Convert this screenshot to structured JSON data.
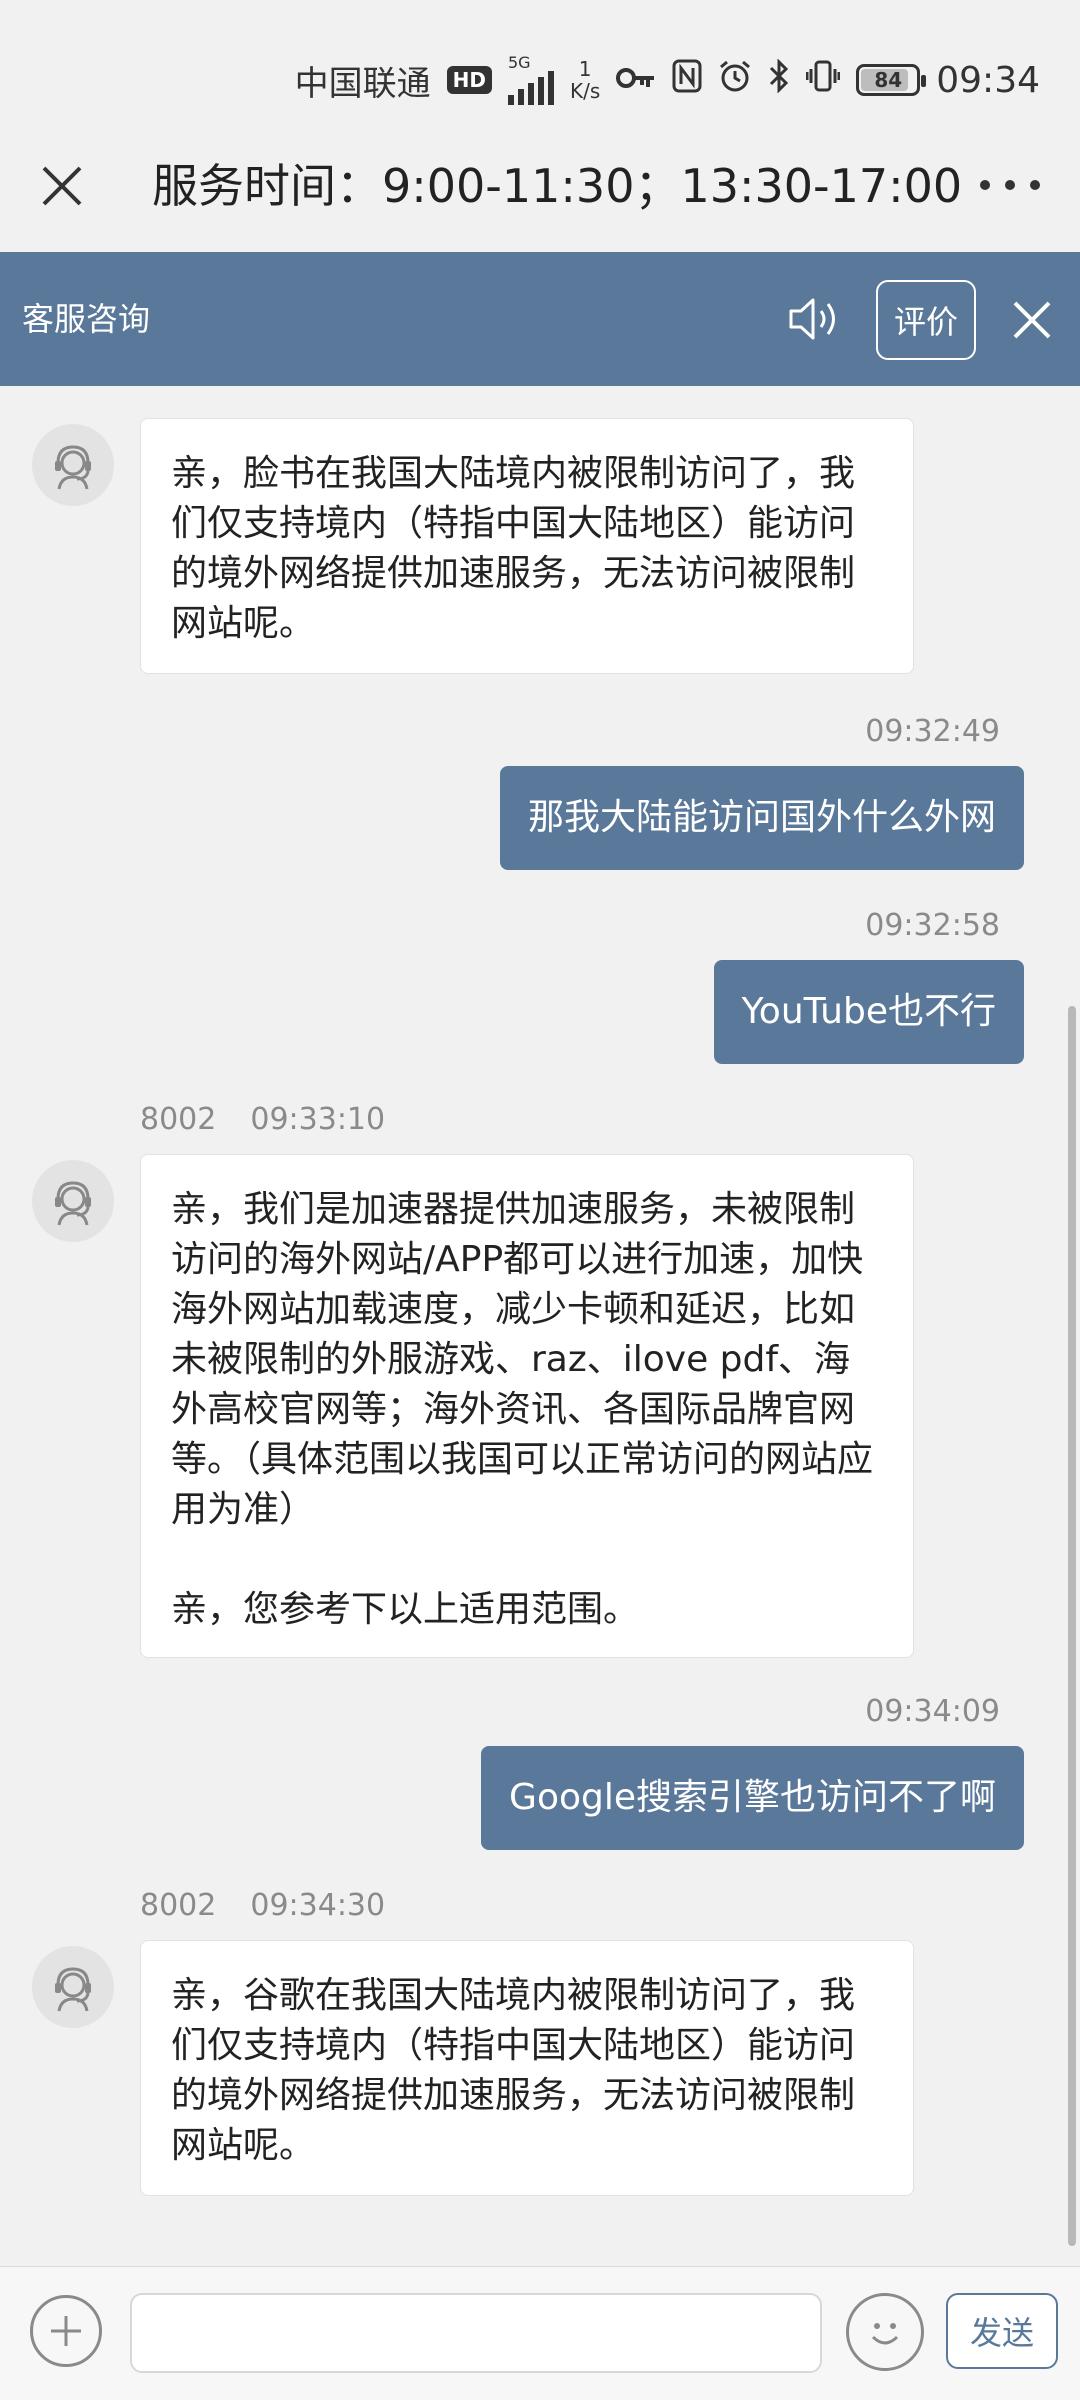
{
  "status_bar": {
    "carrier": "中国联通",
    "hd": "HD",
    "network": "5G",
    "speed_value": "1",
    "speed_unit": "K/s",
    "battery": "84",
    "time": "09:34",
    "icons": [
      "key-icon",
      "nfc-icon",
      "alarm-icon",
      "bluetooth-icon",
      "vibrate-icon"
    ]
  },
  "title_bar": {
    "title": "服务时间：9:00-11:30；13:30-17:00"
  },
  "service_bar": {
    "title": "客服咨询",
    "rate_label": "评价"
  },
  "messages": [
    {
      "id": "m1",
      "side": "in",
      "text": "亲，脸书在我国大陆境内被限制访问了，我们仅支持境内（特指中国大陆地区）能访问的境外网络提供加速服务，无法访问被限制网站呢。"
    },
    {
      "id": "m2",
      "side": "out",
      "time": "09:32:49",
      "text": "那我大陆能访问国外什么外网"
    },
    {
      "id": "m3",
      "side": "out",
      "time": "09:32:58",
      "text": "YouTube也不行"
    },
    {
      "id": "m4",
      "side": "in",
      "sender": "8002",
      "time": "09:33:10",
      "text": "亲，我们是加速器提供加速服务，未被限制访问的海外网站/APP都可以进行加速，加快海外网站加载速度，减少卡顿和延迟，比如未被限制的外服游戏、raz、ilove pdf、海外高校官网等；海外资讯、各国际品牌官网等。（具体范围以我国可以正常访问的网站应用为准）\n\n亲，您参考下以上适用范围。"
    },
    {
      "id": "m5",
      "side": "out",
      "time": "09:34:09",
      "text": "Google搜索引擎也访问不了啊"
    },
    {
      "id": "m6",
      "side": "in",
      "sender": "8002",
      "time": "09:34:30",
      "text": "亲，谷歌在我国大陆境内被限制访问了，我们仅支持境内（特指中国大陆地区）能访问的境外网络提供加速服务，无法访问被限制网站呢。"
    }
  ],
  "input_bar": {
    "value": "",
    "placeholder": "",
    "send_label": "发送"
  },
  "colors": {
    "accent": "#5a7899",
    "background": "#f1f1f1",
    "bubble_in": "#ffffff",
    "meta_text": "#8a8a8a"
  }
}
